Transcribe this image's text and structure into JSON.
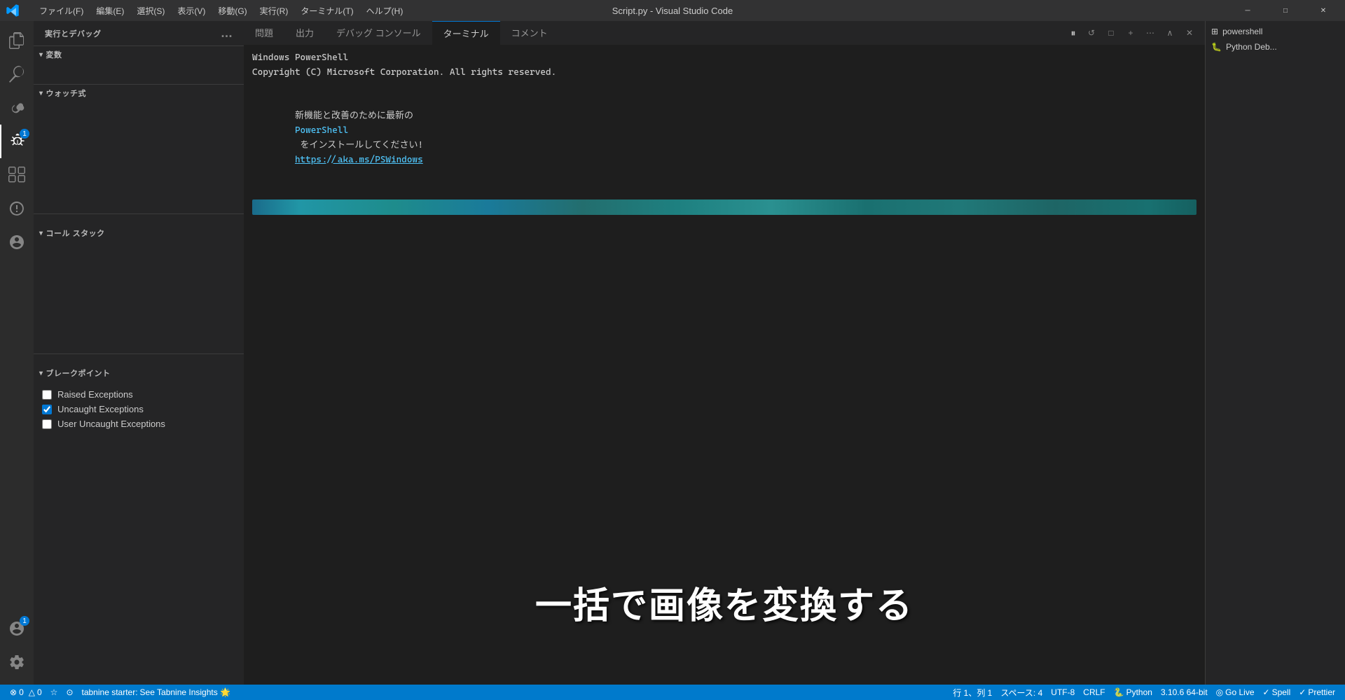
{
  "titleBar": {
    "title": "Script.py - Visual Studio Code",
    "menus": [
      "ファイル(F)",
      "編集(E)",
      "選択(S)",
      "表示(V)",
      "移動(G)",
      "実行(R)",
      "ターミナル(T)",
      "ヘルプ(H)"
    ],
    "windowBtns": [
      "─",
      "□",
      "✕"
    ]
  },
  "activityBar": {
    "icons": [
      {
        "name": "explorer",
        "symbol": "⎘",
        "active": false
      },
      {
        "name": "search",
        "symbol": "🔍",
        "active": false
      },
      {
        "name": "source-control",
        "symbol": "⑂",
        "active": false
      },
      {
        "name": "run-debug",
        "symbol": "▷",
        "active": true,
        "badge": "1"
      },
      {
        "name": "extensions",
        "symbol": "⊞",
        "active": false
      },
      {
        "name": "testing",
        "symbol": "⚗",
        "active": false
      },
      {
        "name": "remote",
        "symbol": "◎",
        "active": false
      }
    ],
    "bottomIcons": [
      {
        "name": "accounts",
        "symbol": "👤",
        "badge": "1"
      },
      {
        "name": "settings",
        "symbol": "⚙"
      }
    ]
  },
  "sidebar": {
    "header": "実行とデバッグ",
    "dotsLabel": "...",
    "sections": {
      "variables": {
        "label": "変数",
        "expanded": true
      },
      "watch": {
        "label": "ウォッチ式",
        "expanded": true
      },
      "callStack": {
        "label": "コール スタック",
        "expanded": true
      },
      "breakpoints": {
        "label": "ブレークポイント",
        "expanded": true,
        "items": [
          {
            "label": "Raised Exceptions",
            "checked": false
          },
          {
            "label": "Uncaught Exceptions",
            "checked": true
          },
          {
            "label": "User Uncaught Exceptions",
            "checked": false
          }
        ]
      }
    }
  },
  "tabs": {
    "items": [
      {
        "label": "問題",
        "active": false
      },
      {
        "label": "出力",
        "active": false
      },
      {
        "label": "デバッグ コンソール",
        "active": false
      },
      {
        "label": "ターミナル",
        "active": true
      },
      {
        "label": "コメント",
        "active": false
      }
    ],
    "pauseBtn": "⏸",
    "refreshBtn": "↺",
    "closeBtn": "□"
  },
  "terminal": {
    "lines": [
      "Windows PowerShell",
      "Copyright (C) Microsoft Corporation. All rights reserved.",
      "",
      "新機能と改善のために最新の PowerShell をインストールしてください!https://aka.ms/PSWindows"
    ],
    "highlightBar": true
  },
  "overlayText": "一括で画像を変換する",
  "rightPanel": {
    "items": [
      {
        "label": "powershell",
        "icon": "⊞"
      },
      {
        "label": "Python Deb...",
        "icon": "🐛"
      }
    ]
  },
  "statusBar": {
    "left": [
      {
        "label": "⊗ 0",
        "icon": "error"
      },
      {
        "label": "△ 0",
        "icon": "warning"
      },
      {
        "label": "☆",
        "icon": "info"
      },
      {
        "label": "⊙",
        "icon": "sync"
      },
      {
        "label": "tabnine starter:",
        "plain": true
      },
      {
        "label": "See Tabnine Insights 🌟"
      }
    ],
    "right": [
      {
        "label": "行 1、列 1"
      },
      {
        "label": "スペース: 4"
      },
      {
        "label": "UTF-8"
      },
      {
        "label": "CRLF"
      },
      {
        "label": "🐍 Python"
      },
      {
        "label": "3.10.6 64-bit"
      },
      {
        "label": "◎ Go Live"
      },
      {
        "label": "✓ Spell"
      },
      {
        "label": "✓ Prettier"
      }
    ]
  }
}
